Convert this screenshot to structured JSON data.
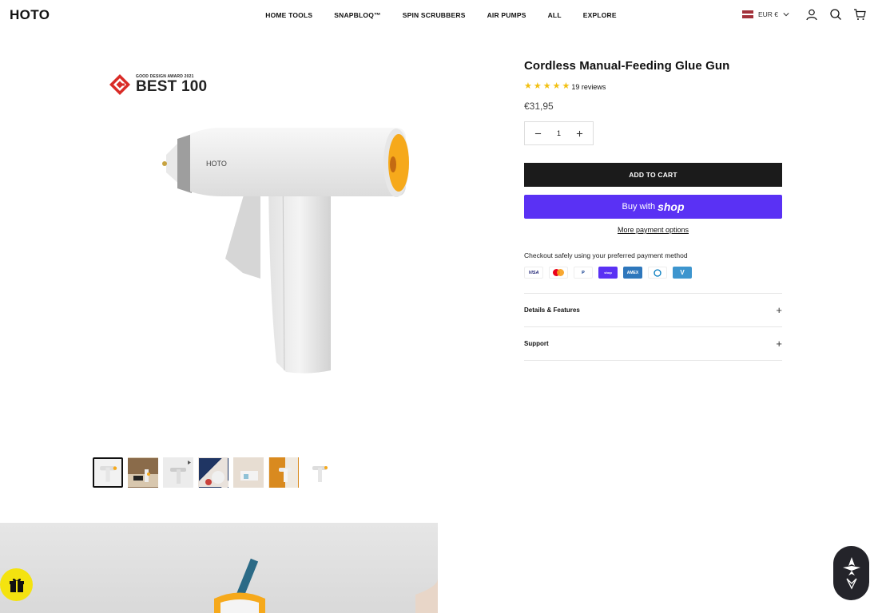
{
  "header": {
    "logo": "HOTO",
    "nav": [
      "HOME TOOLS",
      "SNAPBLOQ™",
      "SPIN SCRUBBERS",
      "AIR PUMPS",
      "ALL",
      "EXPLORE"
    ],
    "currency": "EUR €"
  },
  "gallery": {
    "award_small": "GOOD DESIGN AWARD 2021",
    "award_big": "BEST 100",
    "product_brand": "HOTO"
  },
  "product": {
    "title": "Cordless Manual-Feeding Glue Gun",
    "rating_stars": 5,
    "reviews": "19 reviews",
    "price": "€31,95",
    "quantity": "1",
    "add_to_cart": "ADD TO CART",
    "buy_with": "Buy with",
    "buy_with_brand": "shop",
    "more_payment": "More payment options",
    "checkout_note": "Checkout safely using your preferred payment method",
    "payment_icons": [
      "VISA",
      "mastercard",
      "PayPal",
      "shop pay",
      "AMEX",
      "diners",
      "venmo"
    ]
  },
  "accordion": {
    "details": "Details & Features",
    "support": "Support"
  },
  "colors": {
    "accent_orange": "#f6a91b",
    "shop_purple": "#5a31f4",
    "star_yellow": "#f2c011",
    "gift_yellow": "#f4e30f"
  }
}
